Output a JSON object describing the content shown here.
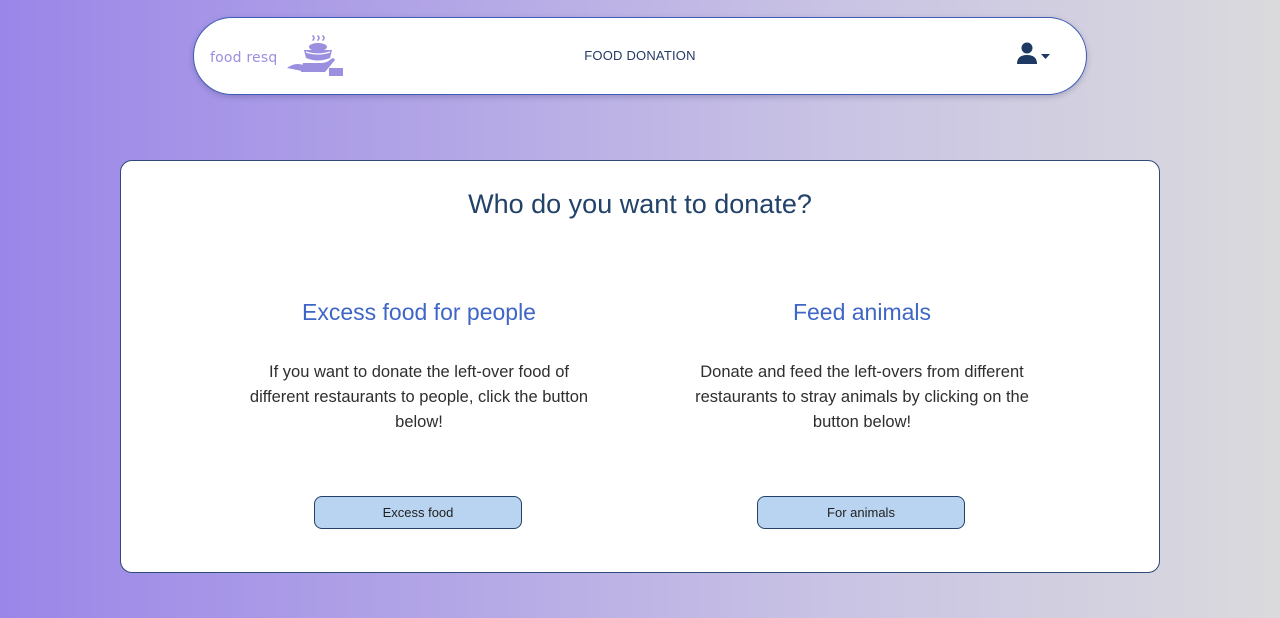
{
  "navbar": {
    "logo_text": "food resq",
    "title": "FOOD DONATION",
    "user_icon": "user-icon",
    "dropdown_icon": "caret-down-icon"
  },
  "main": {
    "heading": "Who do you want to donate?",
    "options": [
      {
        "title": "Excess food for people",
        "description": "If you want to donate the left-over food of different restaurants to people, click the button below!",
        "button_label": "Excess food"
      },
      {
        "title": "Feed animals",
        "description": "Donate and feed the left-overs from different restaurants to stray animals by clicking on the button below!",
        "button_label": "For animals"
      }
    ]
  },
  "colors": {
    "accent": "#3f66c6",
    "heading": "#22426a",
    "button_bg": "#b9d4f0",
    "logo": "#9b8fe0"
  }
}
